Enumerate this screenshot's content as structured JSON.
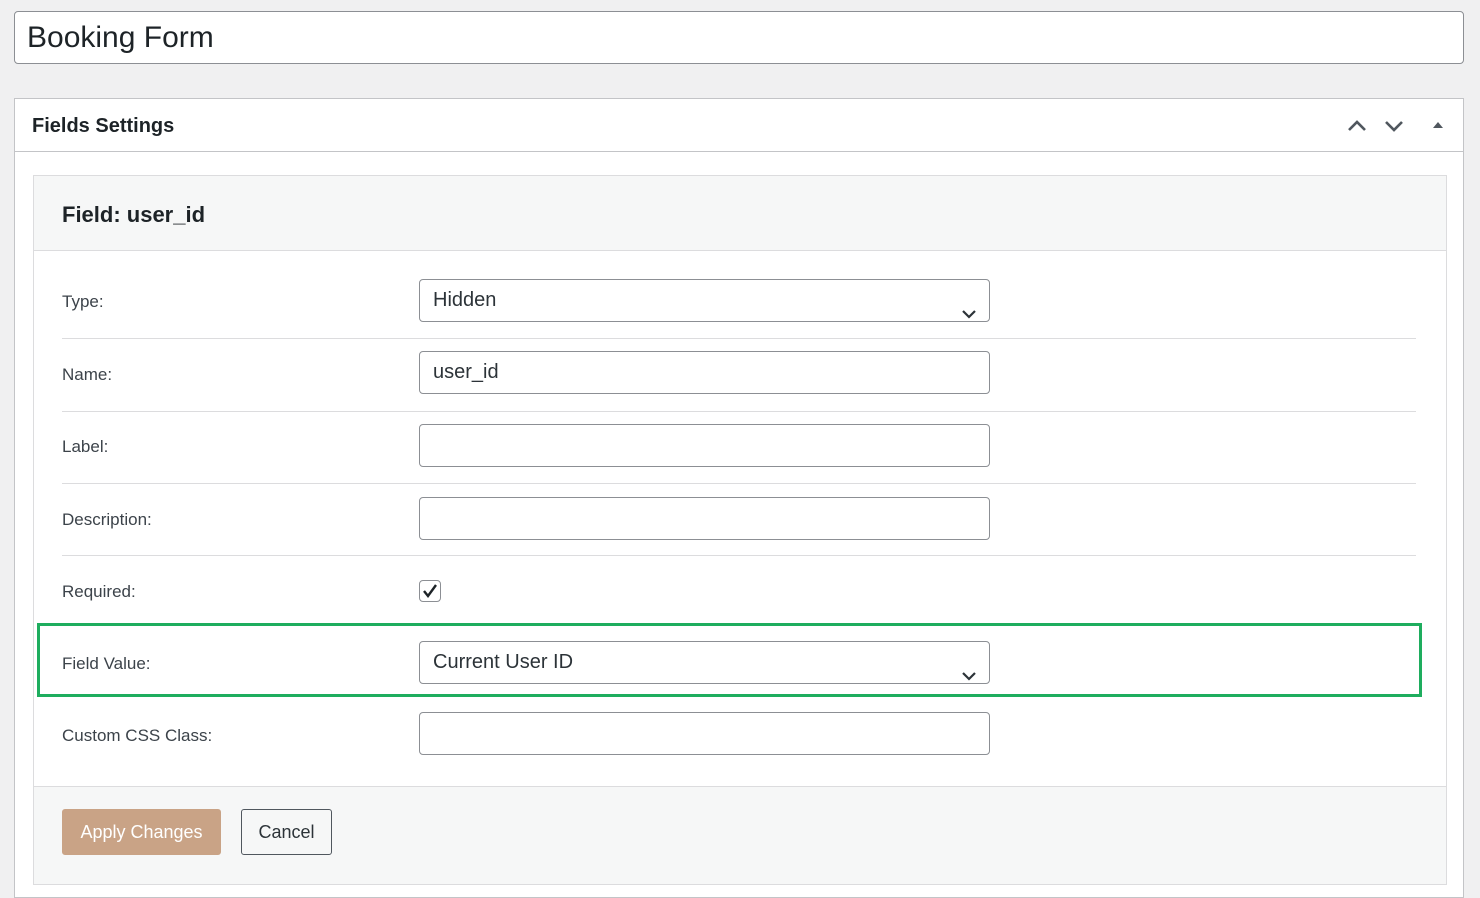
{
  "title_field": {
    "value": "Booking Form"
  },
  "postbox": {
    "title": "Fields Settings",
    "controls": [
      "move-up",
      "move-down",
      "toggle-panel"
    ]
  },
  "field_editor": {
    "heading": "Field: user_id",
    "rows": {
      "type": {
        "label": "Type:",
        "value": "Hidden"
      },
      "name": {
        "label": "Name:",
        "value": "user_id"
      },
      "label": {
        "label": "Label:",
        "value": ""
      },
      "description": {
        "label": "Description:",
        "value": ""
      },
      "required": {
        "label": "Required:",
        "checked": true
      },
      "field_value": {
        "label": "Field Value:",
        "value": "Current User ID"
      },
      "custom_css": {
        "label": "Custom CSS Class:",
        "value": ""
      }
    },
    "buttons": {
      "apply": "Apply Changes",
      "cancel": "Cancel"
    }
  },
  "colors": {
    "highlight": "#1ead5e",
    "apply_button": "#c9a386"
  }
}
